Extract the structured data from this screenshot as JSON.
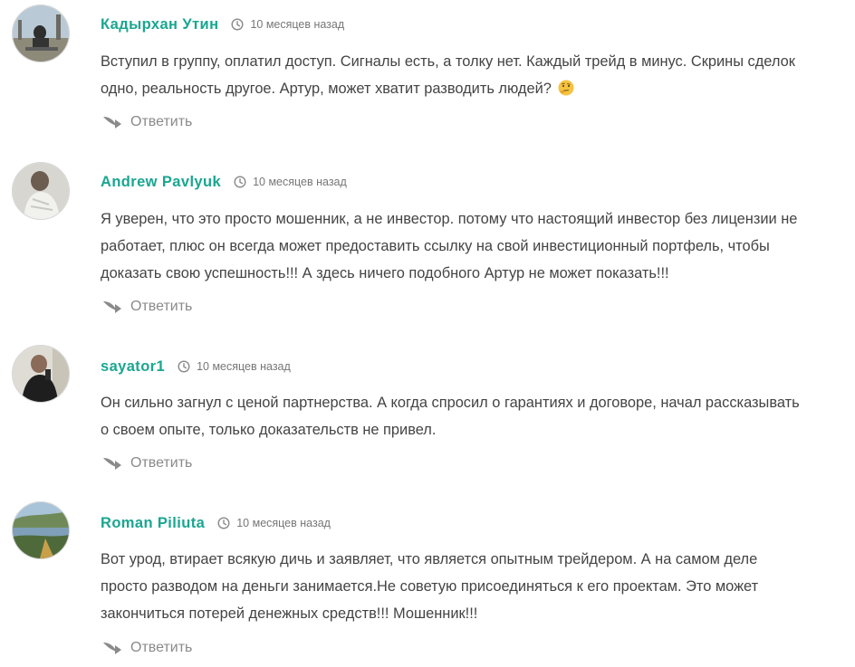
{
  "comments": [
    {
      "author": "Кадырхан Утин",
      "time": "10 месяцев назад",
      "text": [
        "Вступил в группу, оплатил доступ. Сигналы есть, а толку нет. Каждый трейд в минус. Скрины сделок",
        "одно, реальность другое. Артур, может хватит разводить людей?"
      ],
      "emoji": "thinking-face",
      "reply_label": "Ответить"
    },
    {
      "author": "Andrew Pavlyuk",
      "time": "10 месяцев назад",
      "text": [
        "Я уверен, что это просто мошенник, а не инвестор. потому что настоящий инвестор без лицензии не",
        "работает, плюс он всегда может предоставить ссылку на свой инвестиционный портфель, чтобы",
        "доказать свою успешность!!! А здесь ничего подобного Артур не может показать!!!"
      ],
      "reply_label": "Ответить"
    },
    {
      "author": "sayator1",
      "time": "10 месяцев назад",
      "text": [
        "Он сильно загнул с ценой партнерства. А когда спросил о гарантиях и договоре, начал рассказывать",
        "о своем опыте, только доказательств не привел."
      ],
      "reply_label": "Ответить"
    },
    {
      "author": "Roman Piliuta",
      "time": "10 месяцев назад",
      "text": [
        "Вот урод, втирает всякую дичь и заявляет, что является опытным трейдером. А на самом деле",
        "просто разводом на деньги занимается.Не советую присоединяться к его проектам. Это может",
        "закончиться потерей денежных средств!!! Мошенник!!!"
      ],
      "reply_label": "Ответить"
    }
  ],
  "colors": {
    "author": "#1aa690",
    "text": "#444444",
    "meta": "#777777",
    "reply": "#8a8a8a"
  },
  "icons": {
    "time": "clock-icon",
    "reply": "reply-arrow-icon"
  }
}
